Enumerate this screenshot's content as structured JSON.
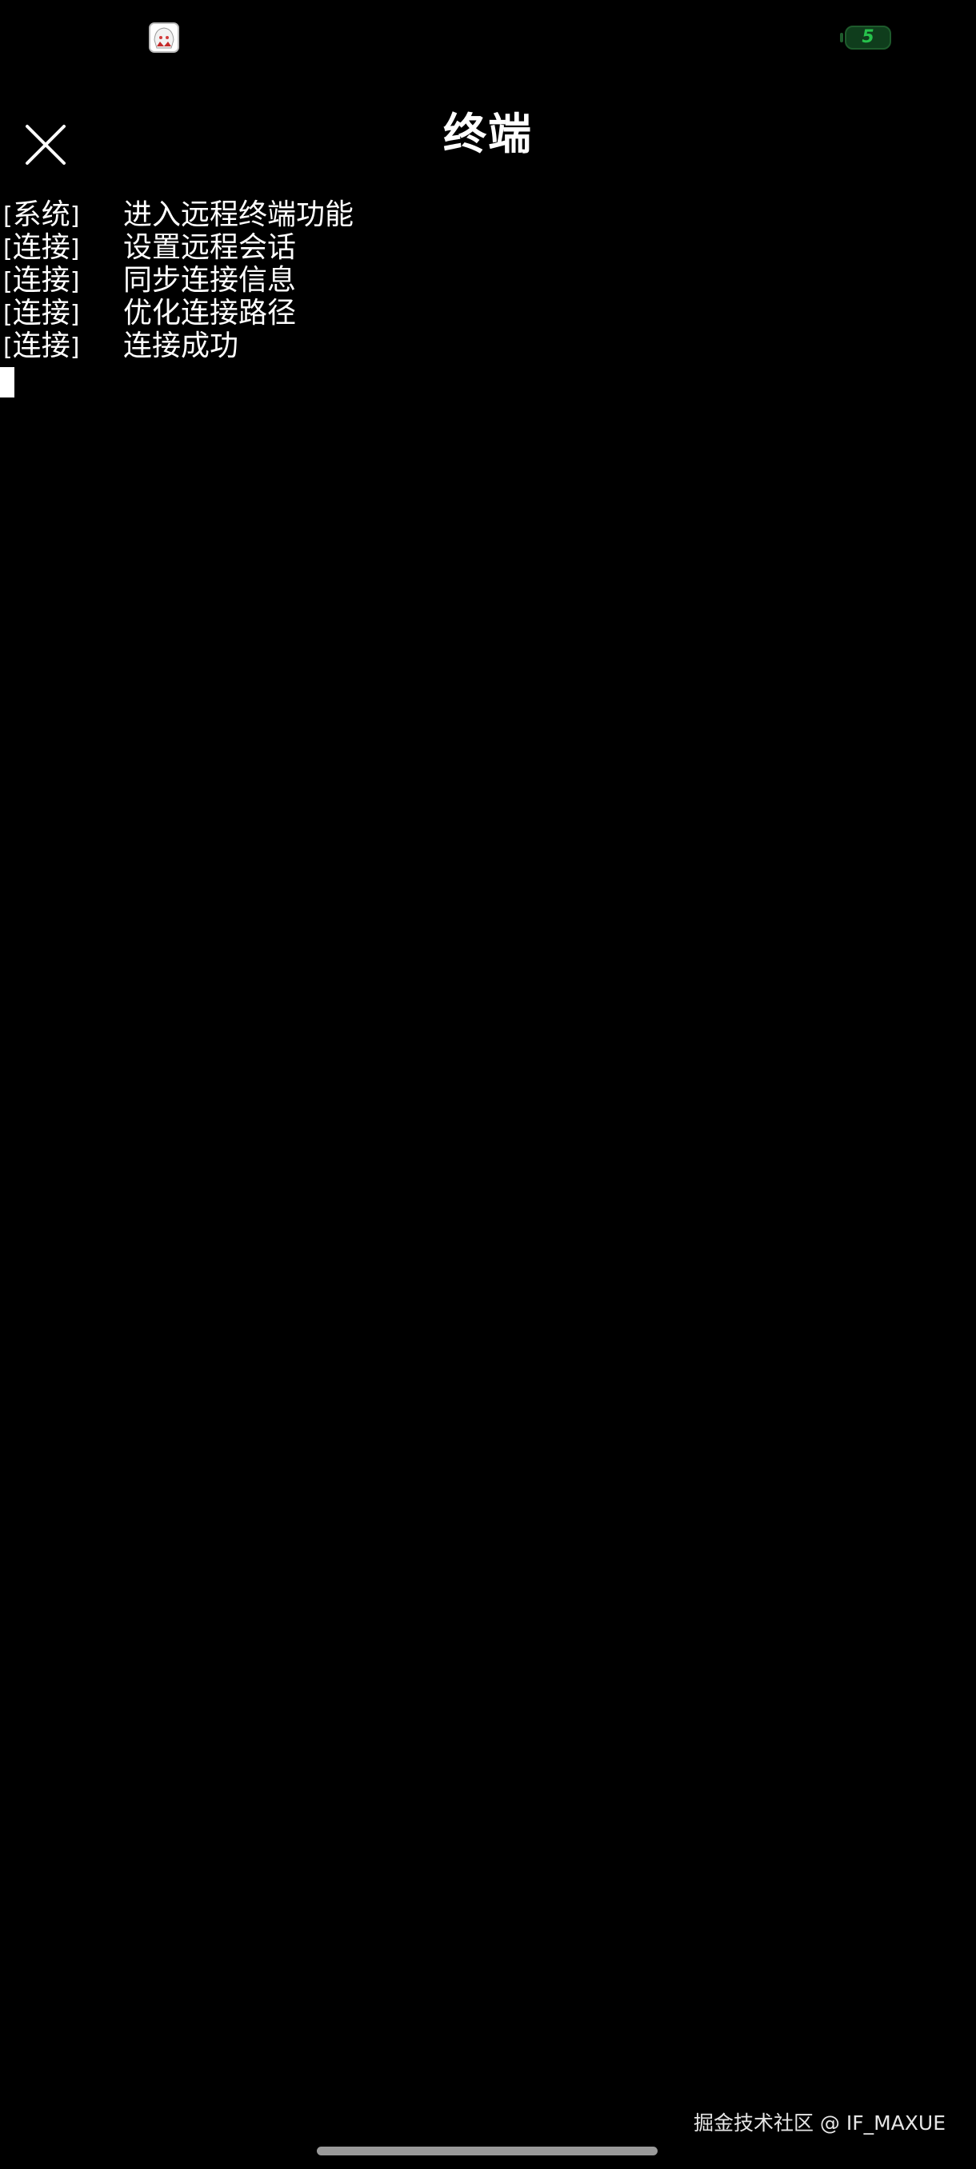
{
  "status_bar": {
    "app_icon": "anime-avatar-icon",
    "battery_icon": "battery-icon",
    "battery_level": "5",
    "battery_color": "#27c24c"
  },
  "header": {
    "title": "终端",
    "close_icon": "close-icon"
  },
  "terminal": {
    "bracket_open": "[",
    "bracket_close": "]",
    "lines": [
      {
        "tag": "系统",
        "message": "进入远程终端功能"
      },
      {
        "tag": "连接",
        "message": "设置远程会话"
      },
      {
        "tag": "连接",
        "message": "同步连接信息"
      },
      {
        "tag": "连接",
        "message": "优化连接路径"
      },
      {
        "tag": "连接",
        "message": "连接成功"
      }
    ]
  },
  "footer": {
    "watermark": "掘金技术社区 @ IF_MAXUE"
  },
  "colors": {
    "background": "#000000",
    "text": "#ffffff"
  }
}
